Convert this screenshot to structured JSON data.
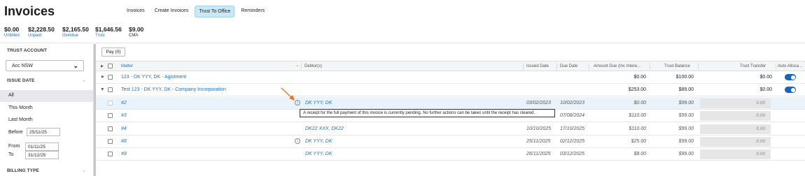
{
  "header": {
    "title": "Invoices",
    "tabs": [
      {
        "label": "Invoices",
        "active": false
      },
      {
        "label": "Create Invoices",
        "active": false
      },
      {
        "label": "Trust To Office",
        "active": true
      },
      {
        "label": "Reminders",
        "active": false
      }
    ]
  },
  "summary": [
    {
      "value": "$0.00",
      "label": "Unbilled"
    },
    {
      "value": "$2,228.50",
      "label": "Unpaid"
    },
    {
      "value": "$2,165.50",
      "label": "Overdue"
    },
    {
      "value": "$1,646.56",
      "label": "Trust"
    },
    {
      "value": "$9.00",
      "label": "CMA"
    }
  ],
  "sidebar": {
    "trust_account_heading": "TRUST ACCOUNT",
    "trust_account_value": "Acc NSW",
    "issue_date_heading": "ISSUE DATE",
    "options": [
      "All",
      "This Month",
      "Last Month"
    ],
    "before_label": "Before",
    "before_value": "25/11/25",
    "from_label": "From",
    "from_value": "01/11/25",
    "to_label": "To",
    "to_value": "31/12/25",
    "billing_type_heading": "BILLING TYPE"
  },
  "toolbar": {
    "pay_label": "Pay (0)"
  },
  "columns": {
    "matter": "Matter",
    "debtors": "Debtor(s)",
    "issued_date": "Issued Date",
    "due_date": "Due Date",
    "amount_due": "Amount Due (Inc Intere...",
    "trust_balance": "Trust Balance",
    "trust_transfer": "Trust Transfer",
    "auto_allocate": "Auto Alloca..."
  },
  "matters": [
    {
      "name": "123 - DK YYY, DK - Agistment",
      "amount_due": "$0.00",
      "trust_balance": "$100.00",
      "trust_transfer": "$0.00",
      "auto_allocate": true,
      "expanded": false
    },
    {
      "name": "Test 123 - DK YYY, DK - Company Incorporation",
      "amount_due": "$253.00",
      "trust_balance": "$89.00",
      "trust_transfer": "$0.00",
      "auto_allocate": true,
      "expanded": true
    }
  ],
  "invoices": [
    {
      "number": "#2",
      "debtor": "DK YYY, DK",
      "issued": "03/02/2023",
      "due": "10/02/2023",
      "amount": "$0.00",
      "balance": "$99.00",
      "transfer": "0.00",
      "info": true,
      "selected": true
    },
    {
      "number": "#3",
      "debtor": "",
      "issued": "",
      "due": "07/08/2024",
      "amount": "$110.00",
      "balance": "$99.00",
      "transfer": "0.00",
      "info": false,
      "selected": false
    },
    {
      "number": "#4",
      "debtor": "DK22 XXX, DK22",
      "issued": "10/10/2025",
      "due": "17/10/2025",
      "amount": "$110.00",
      "balance": "$99.00",
      "transfer": "0.00",
      "info": false,
      "selected": false
    },
    {
      "number": "#8",
      "debtor": "DK YYY, DK",
      "issued": "25/11/2025",
      "due": "02/12/2025",
      "amount": "$25.00",
      "balance": "$99.00",
      "transfer": "0.00",
      "info": true,
      "selected": false
    },
    {
      "number": "#9",
      "debtor": "DK YYY, DK",
      "issued": "26/11/2025",
      "due": "03/12/2025",
      "amount": "$8.00",
      "balance": "$99.00",
      "transfer": "0.00",
      "info": false,
      "selected": false
    }
  ],
  "tooltip": "A receipt for the full payment of this invoice is currently pending. No further actions can be taken until the receipt has cleared.",
  "colors": {
    "accent": "#1a73c8",
    "toggle_on": "#1565c0",
    "active_tab_bg": "#cce7f5",
    "arrow": "#f07020"
  }
}
